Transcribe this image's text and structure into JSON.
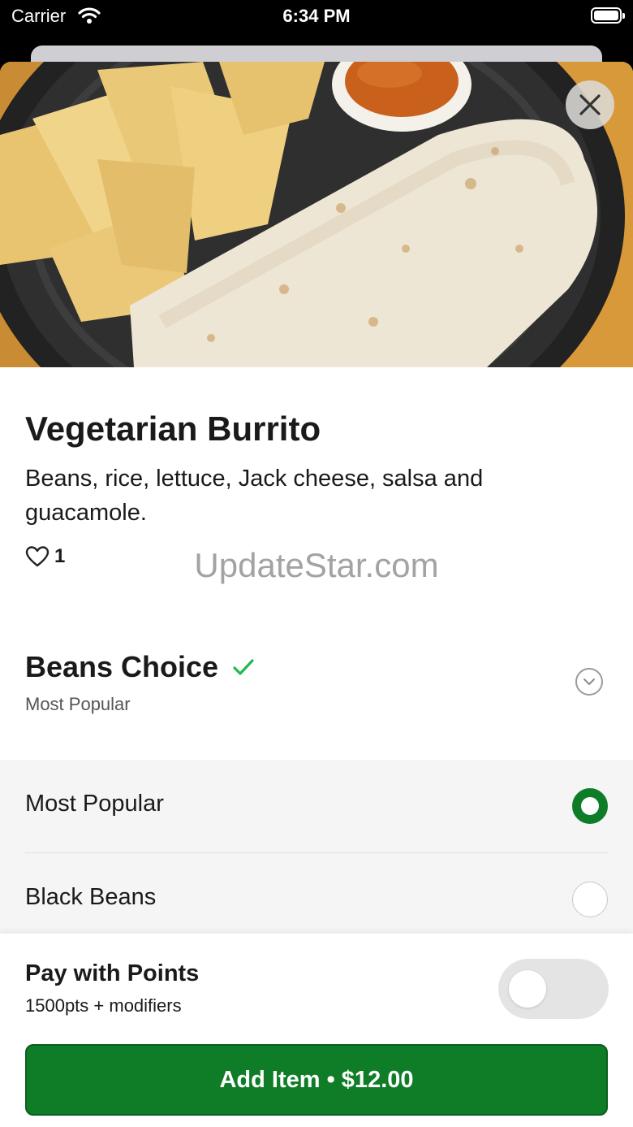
{
  "status_bar": {
    "carrier": "Carrier",
    "time": "6:34 PM"
  },
  "item": {
    "title": "Vegetarian Burrito",
    "description": "Beans, rice, lettuce, Jack cheese, salsa and guacamole.",
    "like_count": "1"
  },
  "watermark": "UpdateStar.com",
  "modifier_group": {
    "title": "Beans Choice",
    "subtitle": "Most Popular",
    "options": [
      {
        "label": "Most Popular",
        "selected": true
      },
      {
        "label": "Black Beans",
        "selected": false
      }
    ]
  },
  "footer": {
    "pay_title": "Pay with Points",
    "pay_subtitle": "1500pts + modifiers",
    "pay_toggle_on": false,
    "add_button_label": "Add Item • $12.00"
  },
  "colors": {
    "accent_green": "#0f7d27",
    "check_green": "#1fb954"
  },
  "icons": {
    "close": "close-icon",
    "like": "heart-icon",
    "check": "checkmark-icon",
    "expand": "chevron-down-icon"
  }
}
